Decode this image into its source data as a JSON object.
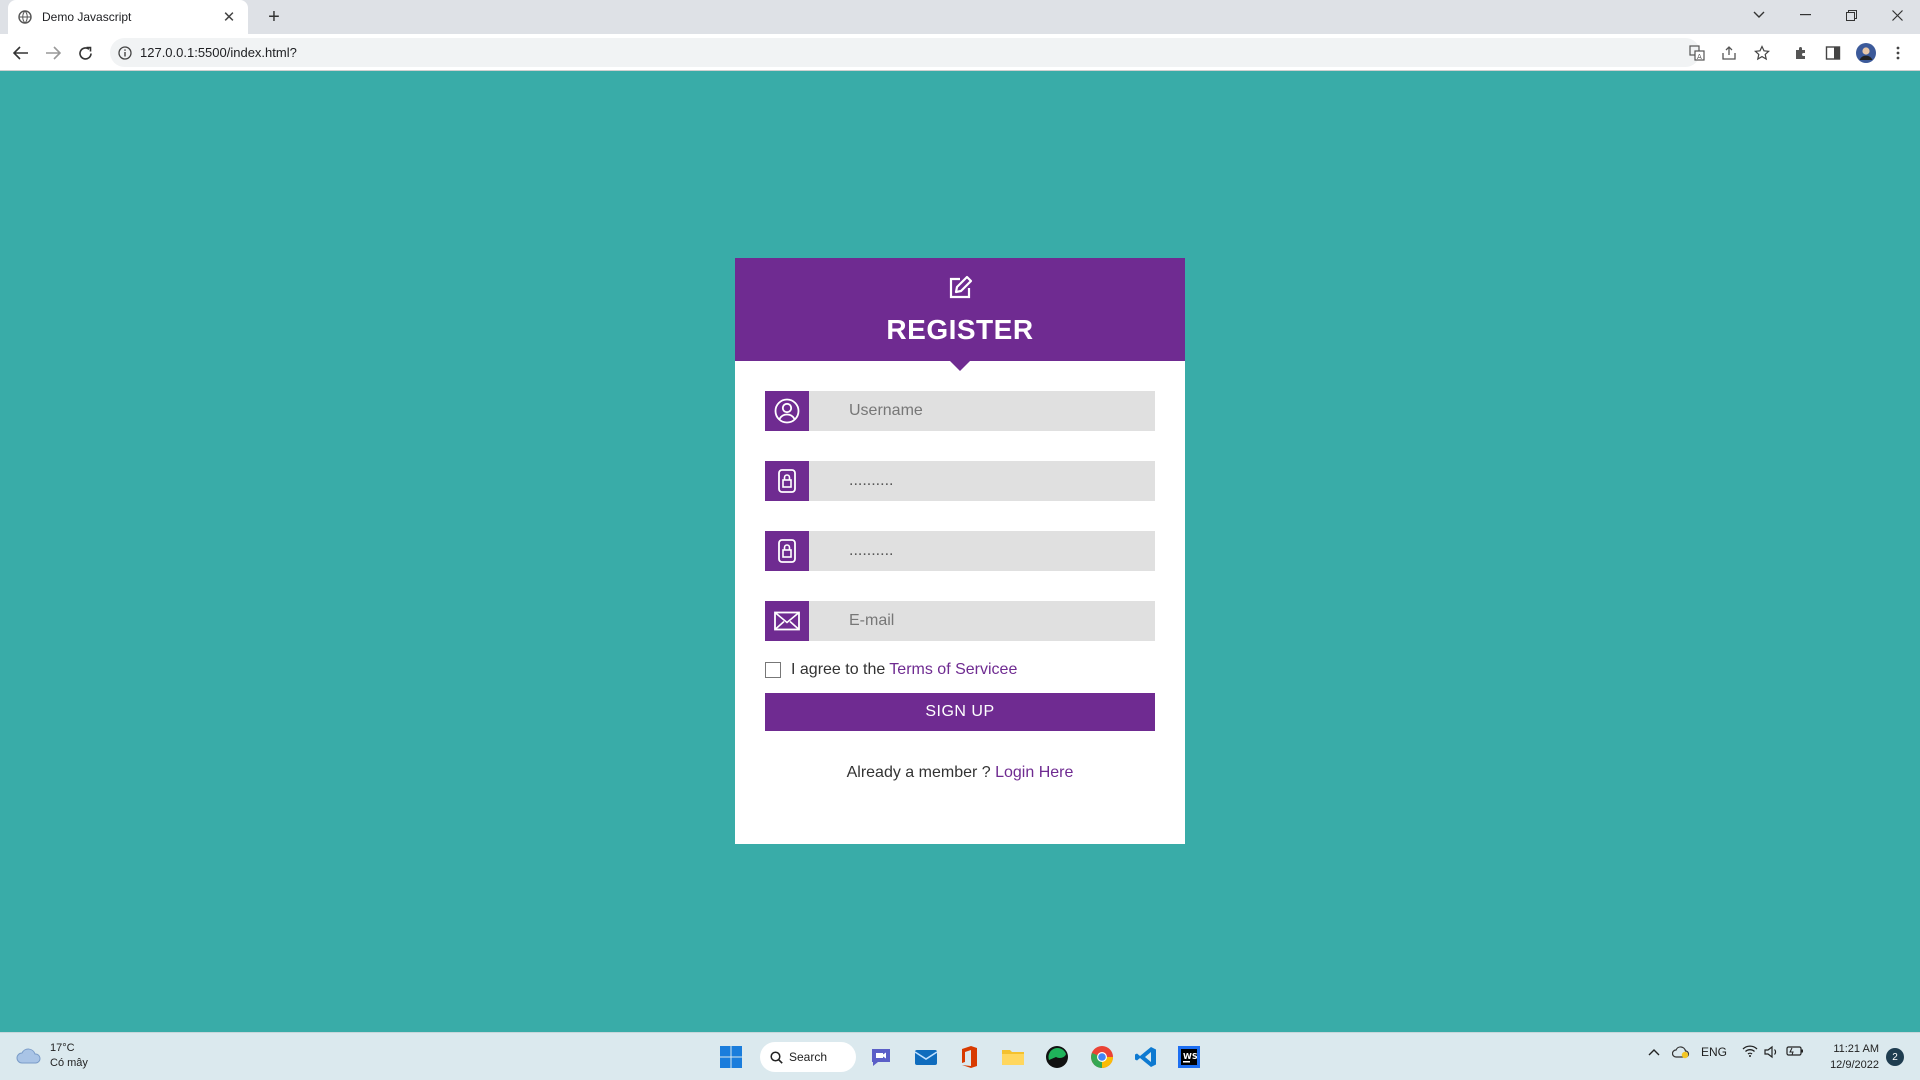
{
  "browser": {
    "tab_title": "Demo Javascript",
    "tab_close": "✕",
    "new_tab": "+",
    "url": "127.0.0.1:5500/index.html?"
  },
  "form": {
    "title": "REGISTER",
    "username_placeholder": "Username",
    "password_value": "..........",
    "confirm_password_value": "..........",
    "email_placeholder": "E-mail",
    "agree_text": "I agree to the",
    "terms_link": "Terms of Servicee",
    "signup_label": "SIGN UP",
    "member_text": "Already a member ?",
    "login_link": "Login Here"
  },
  "taskbar": {
    "temperature": "17°C",
    "weather_desc": "Có mây",
    "search_label": "Search",
    "language": "ENG",
    "time": "11:21 AM",
    "date": "12/9/2022",
    "notification_count": "2"
  },
  "colors": {
    "page_background": "#39aca8",
    "accent": "#6f2b91",
    "input_background": "#e0e0e0"
  }
}
